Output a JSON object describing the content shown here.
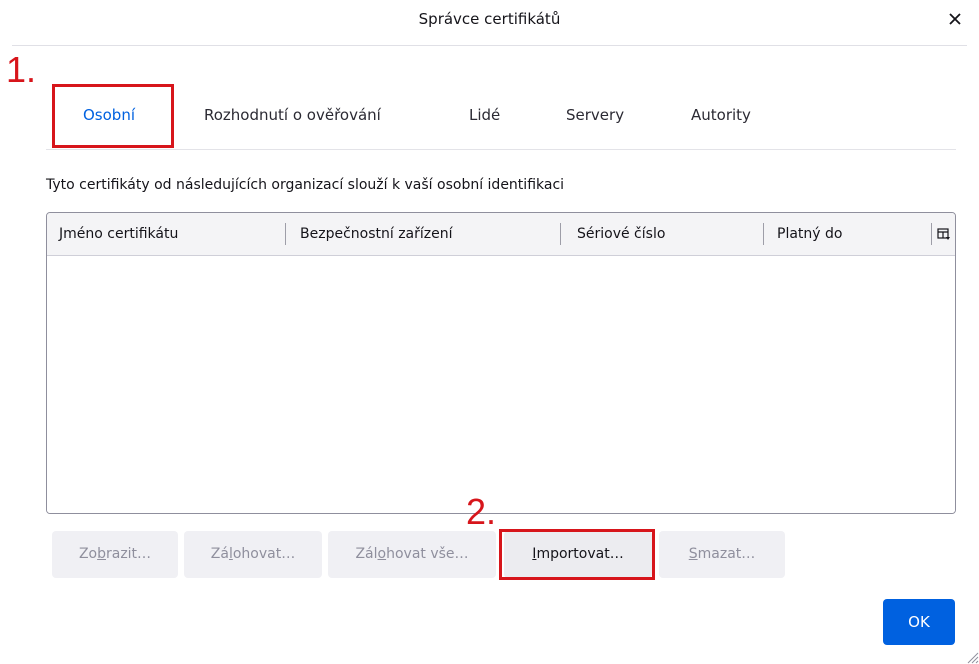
{
  "window": {
    "title": "Správce certifikátů",
    "close_icon": "close-icon"
  },
  "annotations": {
    "step1": "1.",
    "step2": "2.",
    "color": "#d7151b"
  },
  "tabs": [
    {
      "label": "Osobní",
      "selected": true
    },
    {
      "label": "Rozhodnutí o ověřování",
      "selected": false
    },
    {
      "label": "Lidé",
      "selected": false
    },
    {
      "label": "Servery",
      "selected": false
    },
    {
      "label": "Autority",
      "selected": false
    }
  ],
  "description": "Tyto certifikáty od následujících organizací slouží k vaší osobní identifikaci",
  "table": {
    "columns": [
      "Jméno certifikátu",
      "Bezpečnostní zařízení",
      "Sériové číslo",
      "Platný do"
    ],
    "column_picker_icon": "column-picker-icon",
    "rows": []
  },
  "buttons": {
    "view": {
      "pre": "Zo",
      "key": "b",
      "post": "razit…",
      "enabled": false
    },
    "backup": {
      "pre": "Zá",
      "key": "l",
      "post": "ohovat…",
      "enabled": false
    },
    "backup_all": {
      "pre": "Zál",
      "key": "o",
      "post": "hovat vše…",
      "enabled": false
    },
    "import": {
      "pre": "",
      "key": "I",
      "post": "mportovat…",
      "enabled": true
    },
    "delete": {
      "pre": "",
      "key": "S",
      "post": "mazat…",
      "enabled": false
    },
    "ok": "OK"
  },
  "colors": {
    "accent": "#0061e0",
    "highlight": "#d7151b"
  }
}
